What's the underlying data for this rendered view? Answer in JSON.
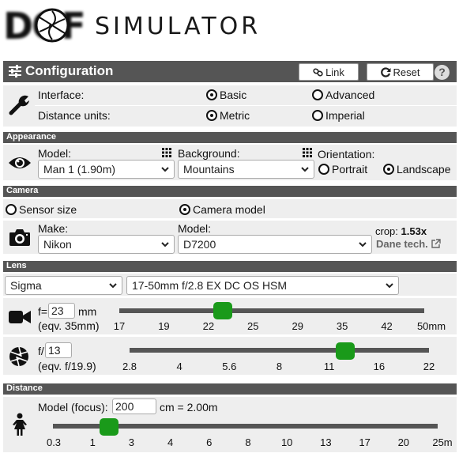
{
  "app": {
    "logo_mark": "DOF",
    "logo_text": "SIMULATOR"
  },
  "config": {
    "title": "Configuration",
    "link_label": "Link",
    "reset_label": "Reset",
    "help_label": "?",
    "interface_label": "Interface:",
    "interface_options": [
      {
        "label": "Basic",
        "selected": true
      },
      {
        "label": "Advanced",
        "selected": false
      }
    ],
    "units_label": "Distance units:",
    "units_options": [
      {
        "label": "Metric",
        "selected": true
      },
      {
        "label": "Imperial",
        "selected": false
      }
    ]
  },
  "appearance": {
    "section": "Appearance",
    "model_label": "Model:",
    "model_value": "Man 1 (1.90m)",
    "background_label": "Background:",
    "background_value": "Mountains",
    "orientation_label": "Orientation:",
    "orientation_options": [
      {
        "label": "Portrait",
        "selected": false
      },
      {
        "label": "Landscape",
        "selected": true
      }
    ]
  },
  "camera": {
    "section": "Camera",
    "mode_options": [
      {
        "label": "Sensor size",
        "selected": false
      },
      {
        "label": "Camera model",
        "selected": true
      }
    ],
    "make_label": "Make:",
    "make_value": "Nikon",
    "model_label": "Model:",
    "model_value": "D7200",
    "crop_label": "crop:",
    "crop_value": "1.53x",
    "tech_link": "Dane tech."
  },
  "lens": {
    "section": "Lens",
    "brand_value": "Sigma",
    "lens_value": "17-50mm f/2.8 EX DC OS HSM",
    "focal": {
      "prefix": "f=",
      "value": "23",
      "unit": "mm",
      "equiv": "(eqv. 35mm)",
      "ticks": [
        "17",
        "19",
        "22",
        "25",
        "29",
        "35",
        "42",
        "50mm"
      ],
      "slider_fraction": 0.34
    },
    "aperture": {
      "prefix": "f/",
      "value": "13",
      "equiv": "(eqv. f/19.9)",
      "ticks": [
        "2.8",
        "4",
        "5.6",
        "8",
        "11",
        "16",
        "22"
      ],
      "slider_fraction": 0.72
    }
  },
  "distance": {
    "section": "Distance",
    "focus_label": "Model (focus):",
    "focus_value": "200",
    "focus_suffix": "cm = 2.00m",
    "ticks": [
      "0.3",
      "1",
      "3",
      "4",
      "6",
      "8",
      "10",
      "13",
      "17",
      "20",
      "25m"
    ],
    "slider_fraction": 0.145
  },
  "colors": {
    "header_bg": "#555555",
    "row_bg": "#eeeeee",
    "slider_thumb": "#1a9a1a",
    "slider_track": "#555555"
  }
}
